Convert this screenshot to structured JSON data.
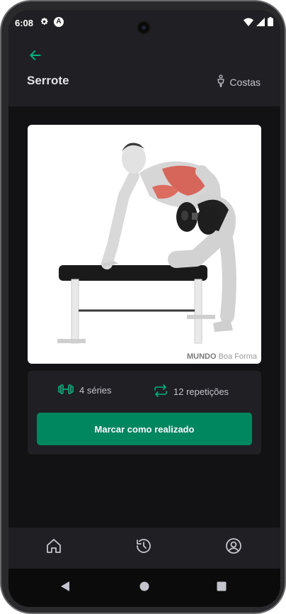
{
  "status_bar": {
    "time": "6:08",
    "notification_badge": "A"
  },
  "header": {
    "back_icon": "arrow-left-icon",
    "title": "Serrote",
    "group_icon": "person-body-icon",
    "group": "Costas"
  },
  "exercise": {
    "image_icon": "one-arm-dumbbell-row-illustration",
    "watermark_brand": "MUNDO",
    "watermark_suffix": " Boa Forma"
  },
  "info": {
    "series_icon": "dumbbell-icon",
    "series": "4 séries",
    "reps_icon": "repeat-icon",
    "reps": "12 repetições",
    "button": "Marcar como realizado"
  },
  "tabs": [
    {
      "icon": "home-icon"
    },
    {
      "icon": "history-icon"
    },
    {
      "icon": "user-circle-icon"
    }
  ],
  "colors": {
    "accent": "#00875f",
    "icon_accent": "#00b37e",
    "background": "#121214",
    "surface": "#202024",
    "text": "#e1e1e6"
  }
}
